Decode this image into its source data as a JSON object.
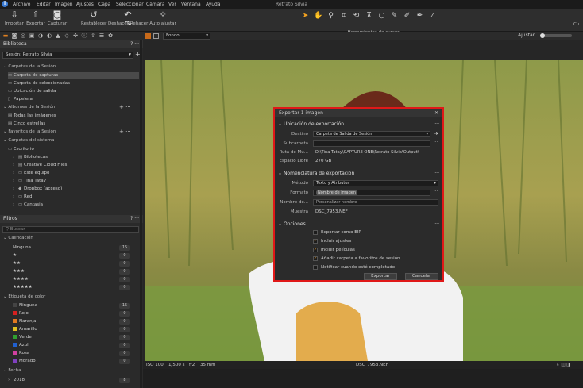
{
  "menu": [
    "Archivo",
    "Editar",
    "Imagen",
    "Ajustes",
    "Capa",
    "Seleccionar",
    "Cámara",
    "Ver",
    "Ventana",
    "Ayuda"
  ],
  "window_title": "Retrato Silvia",
  "toolbar": {
    "left": [
      "Importar",
      "Exportar",
      "Capturar"
    ],
    "mid": [
      "Restablecer",
      "Deshacer/Rehacer",
      "Auto ajustar"
    ],
    "cursor_tools_label": "Herramientas de cursor",
    "right_label": "Cu"
  },
  "viewbar": {
    "style": "Fondo",
    "adjust": "Ajustar"
  },
  "library": {
    "title": "Biblioteca",
    "session": "Sesión: Retrato Silvia",
    "session_folders_title": "Carpetas de la Sesión",
    "session_folders": [
      "Carpeta de capturas",
      "Carpeta de seleccionadas",
      "Ubicación de salida",
      "Papelera"
    ],
    "albums_title": "Álbumes de la Sesión",
    "albums": [
      "Todas las imágenes",
      "Cinco estrellas"
    ],
    "favorites_title": "Favoritos de la Sesión",
    "system_title": "Carpetas del sistema",
    "system": [
      "Escritorio",
      "Bibliotecas",
      "Creative Cloud Files",
      "Este equipo",
      "Tina Tatay",
      "Dropbox (acceso)",
      "Red",
      "Cantasia"
    ]
  },
  "filters": {
    "title": "Filtros",
    "search": "Buscar",
    "rating_title": "Calificación",
    "ratings": [
      {
        "label": "Ninguna",
        "count": "15"
      },
      {
        "label": "★",
        "count": "0"
      },
      {
        "label": "★★",
        "count": "0"
      },
      {
        "label": "★★★",
        "count": "0"
      },
      {
        "label": "★★★★",
        "count": "0"
      },
      {
        "label": "★★★★★",
        "count": "0"
      }
    ],
    "color_title": "Etiqueta de color",
    "colors": [
      {
        "label": "Ninguna",
        "count": "15",
        "color": "#444444"
      },
      {
        "label": "Rojo",
        "count": "0",
        "color": "#d42020"
      },
      {
        "label": "Naranja",
        "count": "0",
        "color": "#e07820"
      },
      {
        "label": "Amarillo",
        "count": "0",
        "color": "#e0c020"
      },
      {
        "label": "Verde",
        "count": "0",
        "color": "#30a030"
      },
      {
        "label": "Azul",
        "count": "0",
        "color": "#2060d0"
      },
      {
        "label": "Rosa",
        "count": "0",
        "color": "#d040a0"
      },
      {
        "label": "Morado",
        "count": "0",
        "color": "#8040c0"
      }
    ],
    "date_title": "Fecha",
    "date": {
      "label": "2018",
      "count": "8"
    }
  },
  "statusbar": {
    "iso": "ISO 100",
    "shutter": "1/500 s",
    "aperture": "f/2",
    "focal": "35 mm",
    "filename": "DSC_7953.NEF"
  },
  "dialog": {
    "title": "Exportar 1 imagen",
    "location_title": "Ubicación de exportación",
    "dest_label": "Destino",
    "dest_value": "Carpeta de Salida de Sesión",
    "subfolder_label": "Subcarpeta",
    "path_label": "Ruta de Mu...",
    "path_value": "D:\\Tina Tatay\\CAPTURE ONE\\Retrato Silvia\\Output\\",
    "space_label": "Espacio Libre",
    "space_value": "270 GB",
    "naming_title": "Nomenclatura de exportación",
    "method_label": "Método",
    "method_value": "Texto y Atributos",
    "format_label": "Formato",
    "format_value": "Nombre de imagen",
    "name_label": "Nombre de...",
    "name_value": "Personalizar nombre",
    "sample_label": "Muestra",
    "sample_value": "DSC_7953.NEF",
    "options_title": "Opciones",
    "options": [
      {
        "label": "Exportar como EIP",
        "checked": false
      },
      {
        "label": "Incluir ajustes",
        "checked": true
      },
      {
        "label": "Incluir películas",
        "checked": true
      },
      {
        "label": "Añadir carpeta a favoritos de sesión",
        "checked": true
      },
      {
        "label": "Notificar cuando esté completado",
        "checked": false
      }
    ],
    "export_btn": "Exportar",
    "cancel_btn": "Cancelar"
  }
}
